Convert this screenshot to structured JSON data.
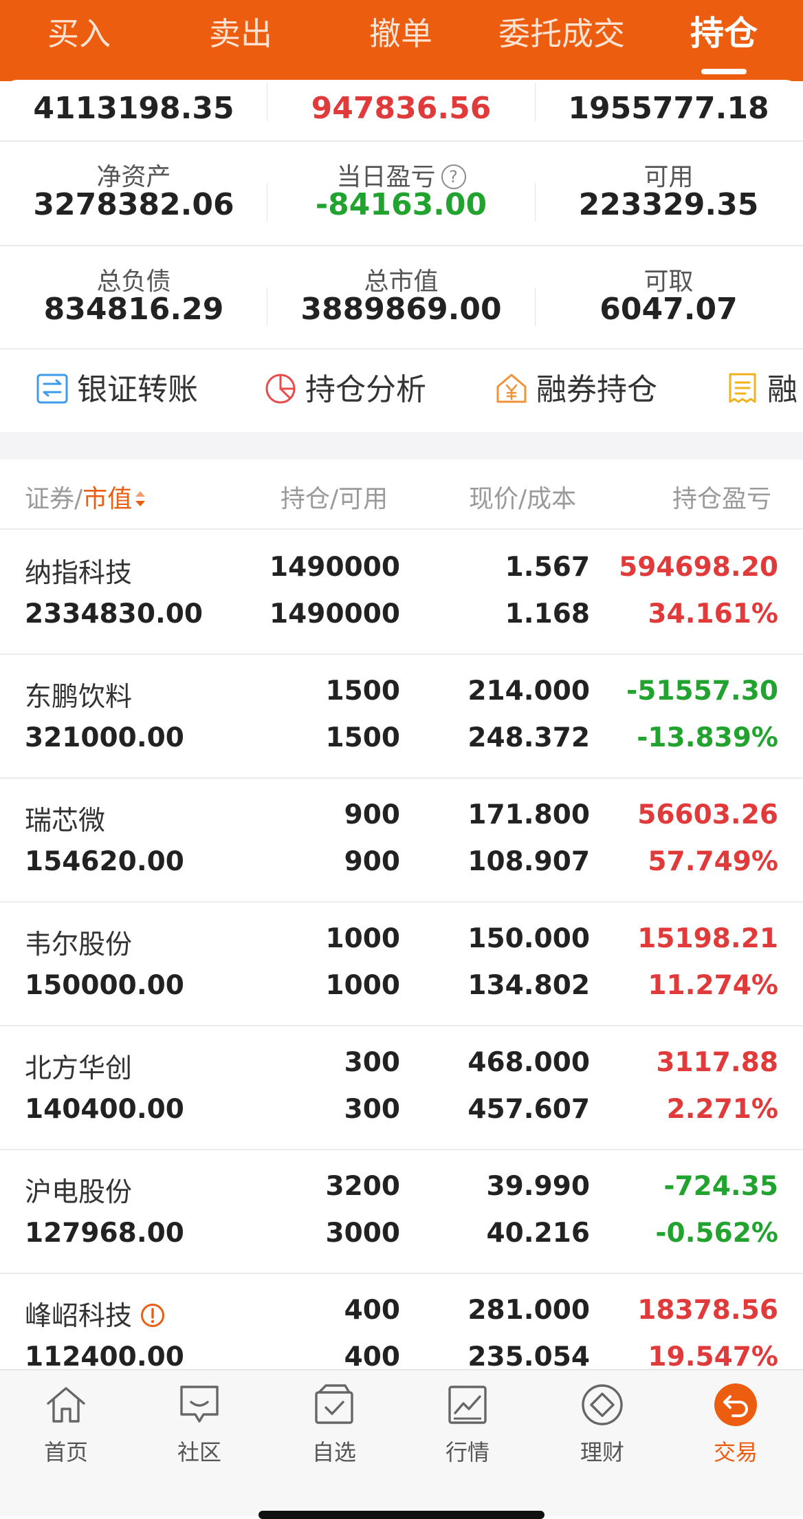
{
  "header": {
    "tabs": [
      {
        "label": "买入"
      },
      {
        "label": "卖出"
      },
      {
        "label": "撤单"
      },
      {
        "label": "委托成交"
      },
      {
        "label": "持仓",
        "active": true
      }
    ]
  },
  "summary": {
    "top": [
      "4113198.35",
      "947836.56",
      "1955777.18"
    ],
    "net_assets": {
      "label": "净资产",
      "value": "3278382.06"
    },
    "daily_pl": {
      "label": "当日盈亏",
      "value": "-84163.00"
    },
    "available": {
      "label": "可用",
      "value": "223329.35"
    },
    "total_liabilities": {
      "label": "总负债",
      "value": "834816.29"
    },
    "total_market_value": {
      "label": "总市值",
      "value": "3889869.00"
    },
    "withdrawable": {
      "label": "可取",
      "value": "6047.07"
    }
  },
  "quick_actions": [
    {
      "label": "银证转账",
      "icon": "transfer-icon"
    },
    {
      "label": "持仓分析",
      "icon": "pie-chart-icon"
    },
    {
      "label": "融券持仓",
      "icon": "yen-house-icon"
    },
    {
      "label": "融",
      "icon": "receipt-icon"
    }
  ],
  "table": {
    "headers": {
      "col1_a": "证券",
      "sep": "/",
      "col1_b": "市值",
      "col2": "持仓/可用",
      "col3": "现价/成本",
      "col4": "持仓盈亏"
    },
    "rows": [
      {
        "name": "纳指科技",
        "market_value": "2334830.00",
        "position": "1490000",
        "available": "1490000",
        "price": "1.567",
        "cost": "1.168",
        "pl": "594698.20",
        "pl_pct": "34.161%",
        "trend": "up"
      },
      {
        "name": "东鹏饮料",
        "market_value": "321000.00",
        "position": "1500",
        "available": "1500",
        "price": "214.000",
        "cost": "248.372",
        "pl": "-51557.30",
        "pl_pct": "-13.839%",
        "trend": "down"
      },
      {
        "name": "瑞芯微",
        "market_value": "154620.00",
        "position": "900",
        "available": "900",
        "price": "171.800",
        "cost": "108.907",
        "pl": "56603.26",
        "pl_pct": "57.749%",
        "trend": "up"
      },
      {
        "name": "韦尔股份",
        "market_value": "150000.00",
        "position": "1000",
        "available": "1000",
        "price": "150.000",
        "cost": "134.802",
        "pl": "15198.21",
        "pl_pct": "11.274%",
        "trend": "up"
      },
      {
        "name": "北方华创",
        "market_value": "140400.00",
        "position": "300",
        "available": "300",
        "price": "468.000",
        "cost": "457.607",
        "pl": "3117.88",
        "pl_pct": "2.271%",
        "trend": "up"
      },
      {
        "name": "沪电股份",
        "market_value": "127968.00",
        "position": "3200",
        "available": "3000",
        "price": "39.990",
        "cost": "40.216",
        "pl": "-724.35",
        "pl_pct": "-0.562%",
        "trend": "down"
      },
      {
        "name": "峰岹科技",
        "market_value": "112400.00",
        "position": "400",
        "available": "400",
        "price": "281.000",
        "cost": "235.054",
        "pl": "18378.56",
        "pl_pct": "19.547%",
        "trend": "up",
        "warning": true
      }
    ]
  },
  "tabbar": [
    {
      "label": "首页",
      "icon": "home-icon"
    },
    {
      "label": "社区",
      "icon": "chat-icon"
    },
    {
      "label": "自选",
      "icon": "watchlist-icon"
    },
    {
      "label": "行情",
      "icon": "market-chart-icon"
    },
    {
      "label": "理财",
      "icon": "diamond-icon"
    },
    {
      "label": "交易",
      "icon": "trade-icon",
      "active": true
    }
  ],
  "colors": {
    "accent": "#ec5d10",
    "up": "#e03a3a",
    "down": "#22a32f"
  }
}
